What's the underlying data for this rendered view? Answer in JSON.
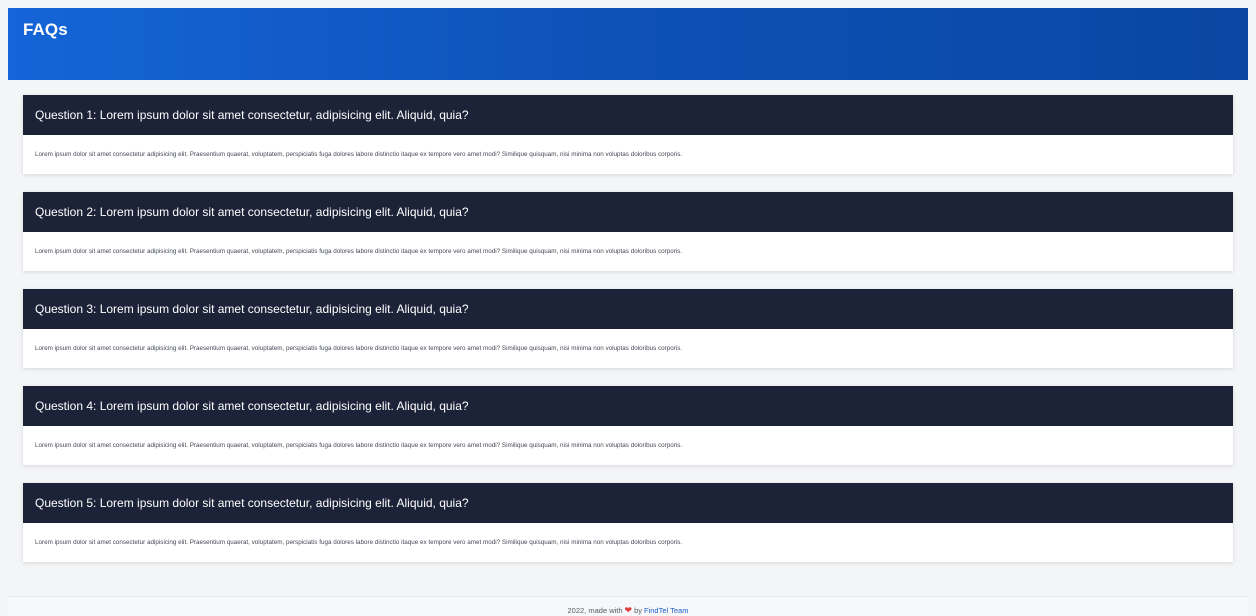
{
  "header": {
    "title": "FAQs"
  },
  "faqs": [
    {
      "question": "Question 1: Lorem ipsum dolor sit amet consectetur, adipisicing elit. Aliquid, quia?",
      "answer": "Lorem ipsum dolor sit amet consectetur adipisicing elit. Praesentium quaerat, voluptatem, perspiciatis fuga dolores labore distinctio itaque ex tempore vero amet modi? Similique quisquam, nisi minima non voluptas doloribus corporis."
    },
    {
      "question": "Question 2: Lorem ipsum dolor sit amet consectetur, adipisicing elit. Aliquid, quia?",
      "answer": "Lorem ipsum dolor sit amet consectetur adipisicing elit. Praesentium quaerat, voluptatem, perspiciatis fuga dolores labore distinctio itaque ex tempore vero amet modi? Similique quisquam, nisi minima non voluptas doloribus corporis."
    },
    {
      "question": "Question 3: Lorem ipsum dolor sit amet consectetur, adipisicing elit. Aliquid, quia?",
      "answer": "Lorem ipsum dolor sit amet consectetur adipisicing elit. Praesentium quaerat, voluptatem, perspiciatis fuga dolores labore distinctio itaque ex tempore vero amet modi? Similique quisquam, nisi minima non voluptas doloribus corporis."
    },
    {
      "question": "Question 4: Lorem ipsum dolor sit amet consectetur, adipisicing elit. Aliquid, quia?",
      "answer": "Lorem ipsum dolor sit amet consectetur adipisicing elit. Praesentium quaerat, voluptatem, perspiciatis fuga dolores labore distinctio itaque ex tempore vero amet modi? Similique quisquam, nisi minima non voluptas doloribus corporis."
    },
    {
      "question": "Question 5: Lorem ipsum dolor sit amet consectetur, adipisicing elit. Aliquid, quia?",
      "answer": "Lorem ipsum dolor sit amet consectetur adipisicing elit. Praesentium quaerat, voluptatem, perspiciatis fuga dolores labore distinctio itaque ex tempore vero amet modi? Similique quisquam, nisi minima non voluptas doloribus corporis."
    }
  ],
  "footer": {
    "prefix": "2022, made with",
    "heart_icon": "heart-icon",
    "by": "by",
    "team_link": "FindTel Team"
  },
  "colors": {
    "header_gradient_start": "#1565d8",
    "header_gradient_end": "#0a47a3",
    "question_bg": "#1c2238",
    "heart": "#e03b3b",
    "link": "#1a5fc8"
  }
}
